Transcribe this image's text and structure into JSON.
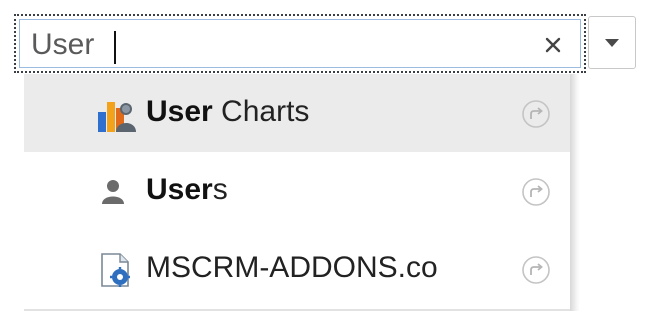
{
  "search": {
    "value": "User",
    "clear_symbol": "×"
  },
  "dropdown": {
    "icon": "caret-down-icon"
  },
  "results": [
    {
      "highlight": "User",
      "rest": " Charts",
      "icon": "user-charts-icon",
      "selected": true
    },
    {
      "highlight": "User",
      "rest": "s",
      "icon": "user-icon",
      "selected": false
    },
    {
      "highlight": "",
      "rest": "MSCRM-ADDONS.co",
      "icon": "web-resource-icon",
      "selected": false
    }
  ],
  "colors": {
    "selected_row": "#ebebeb",
    "input_border": "#9bbce0",
    "accent_blue": "#2f6fbf"
  }
}
